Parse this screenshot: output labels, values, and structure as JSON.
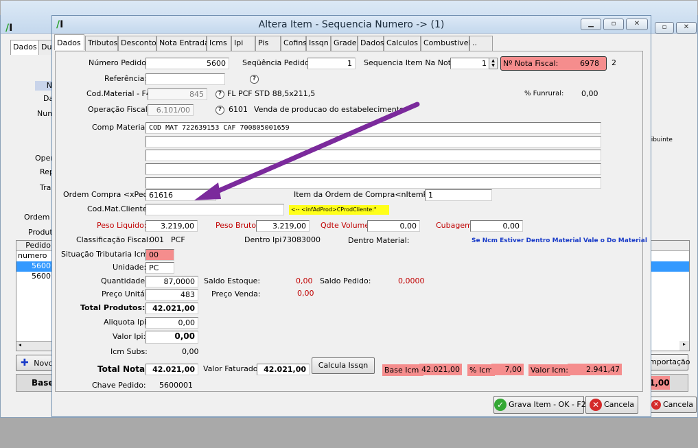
{
  "bg_left": {
    "tabs": [
      "Dados",
      "Du"
    ],
    "labels": [
      "N",
      "Da",
      "Num",
      "Oper",
      "Rep",
      "Tra",
      "Ordem C",
      "Produto"
    ],
    "grid_header": "Pedido",
    "grid_rows": [
      "numero",
      "5600",
      "5600"
    ],
    "novo_label": "Novo",
    "base_label": "Base"
  },
  "bg_right": {
    "label_contribuinte": "ribuinte",
    "importacao_label": "mportação",
    "total_value": "1,00",
    "cancel_label": "Cancela"
  },
  "dialog": {
    "title": "Altera Item - Sequencia Numero ->  (1)",
    "tabs": [
      "Dados",
      "Tributos",
      "Desconto",
      "Nota Entrada",
      "Icms",
      "Ipi",
      "Pis",
      "Cofins",
      "Issqn",
      "Grade",
      "Dados",
      "Calculos",
      "Combustivel",
      ".."
    ]
  },
  "form": {
    "numero_pedido_label": "Número Pedido:",
    "numero_pedido": "5600",
    "sequencia_pedido_label": "Seqüência Pedido:",
    "sequencia_pedido": "1",
    "sequencia_item_label": "Sequencia Item Na Nota:",
    "sequencia_item": "1",
    "nota_fiscal_label": "Nº Nota Fiscal:",
    "nota_fiscal": "6978",
    "nota_fiscal_serie": "2",
    "referencia_label": "Referência:",
    "cod_material_label": "Cod.Material - F4:",
    "cod_material": "845",
    "cod_material_desc": "FL PCF STD 88,5x211,5",
    "funrural_label": "% Funrural:",
    "funrural": "0,00",
    "operacao_fiscal_label": "Operação Fiscal:",
    "operacao_fiscal": "6.101/00",
    "operacao_code": "6101",
    "operacao_desc": "Venda de producao do estabelecimento",
    "comp_material_label": "Comp Material :",
    "comp_material_lines": [
      "COD MAT 722639153 CAF 700805001659",
      "",
      "",
      "",
      ""
    ],
    "ordem_compra_label": "Ordem Compra <xPed>:",
    "ordem_compra": "61616",
    "item_ordem_label": "Item da Ordem de Compra<nItemPed>:",
    "item_ordem": "1",
    "cod_mat_cliente_label": "Cod.Mat.Cliente:",
    "cod_mat_cliente_hint": "<-- <infAdProd>CProdCliente:\"",
    "peso_liquido_label": "Peso Liquido:",
    "peso_liquido": "3.219,00",
    "peso_bruto_label": "Peso Bruto:",
    "peso_bruto": "3.219,00",
    "qdte_volume_label": "Qdte Volume:",
    "qdte_volume": "0,00",
    "cubagem_label": "Cubagem:",
    "cubagem": "0,00",
    "classificacao_label": "Classificação Fiscal:",
    "classificacao_code": "001",
    "classificacao_desc": "PCF",
    "dentro_ipi_label": "Dentro Ipi",
    "dentro_ipi": "73083000",
    "dentro_material_label": "Dentro Material:",
    "ncm_note": "Se Ncm Estiver Dentro Material Vale o Do Material",
    "situacao_label": "Situação Tributaria Icms:",
    "situacao": "00",
    "unidade_label": "Unidade:",
    "unidade": "PC",
    "quantidade_label": "Quantidade:",
    "quantidade": "87,0000",
    "saldo_estoque_label": "Saldo Estoque:",
    "saldo_estoque": "0,00",
    "saldo_pedido_label": "Saldo Pedido:",
    "saldo_pedido": "0,0000",
    "preco_unitario_label": "Preço Unitário:",
    "preco_unitario": "483",
    "preco_venda_label": "Preço Venda:",
    "preco_venda": "0,00",
    "total_produtos_label": "Total Produtos:",
    "total_produtos": "42.021,00",
    "aliquota_ipi_label": "Aliquota Ipi:",
    "aliquota_ipi": "0,00",
    "valor_ipi_label": "Valor Ipi:",
    "valor_ipi": "0,00",
    "icm_subs_label": "Icm Subs:",
    "icm_subs": "0,00",
    "total_nota_label": "Total Nota:",
    "total_nota": "42.021,00",
    "valor_faturado_label": "Valor Faturado:",
    "valor_faturado": "42.021,00",
    "calcula_issqn_label": "Calcula Issqn",
    "base_icm_label": "Base Icm:",
    "base_icm": "42.021,00",
    "pct_icm_label": "% Icm",
    "pct_icm": "7,00",
    "valor_icm_label": "Valor Icm:",
    "valor_icm": "2.941,47",
    "chave_pedido_label": "Chave Pedido:",
    "chave_pedido": "5600001"
  },
  "footer": {
    "grava_label": "Grava Item - OK - F2",
    "cancela_label": "Cancela"
  },
  "colors": {
    "pink": "#f58d8d",
    "red_label": "#c00000",
    "arrow": "#7b2a9c",
    "hint_bg": "#ffff1a"
  }
}
